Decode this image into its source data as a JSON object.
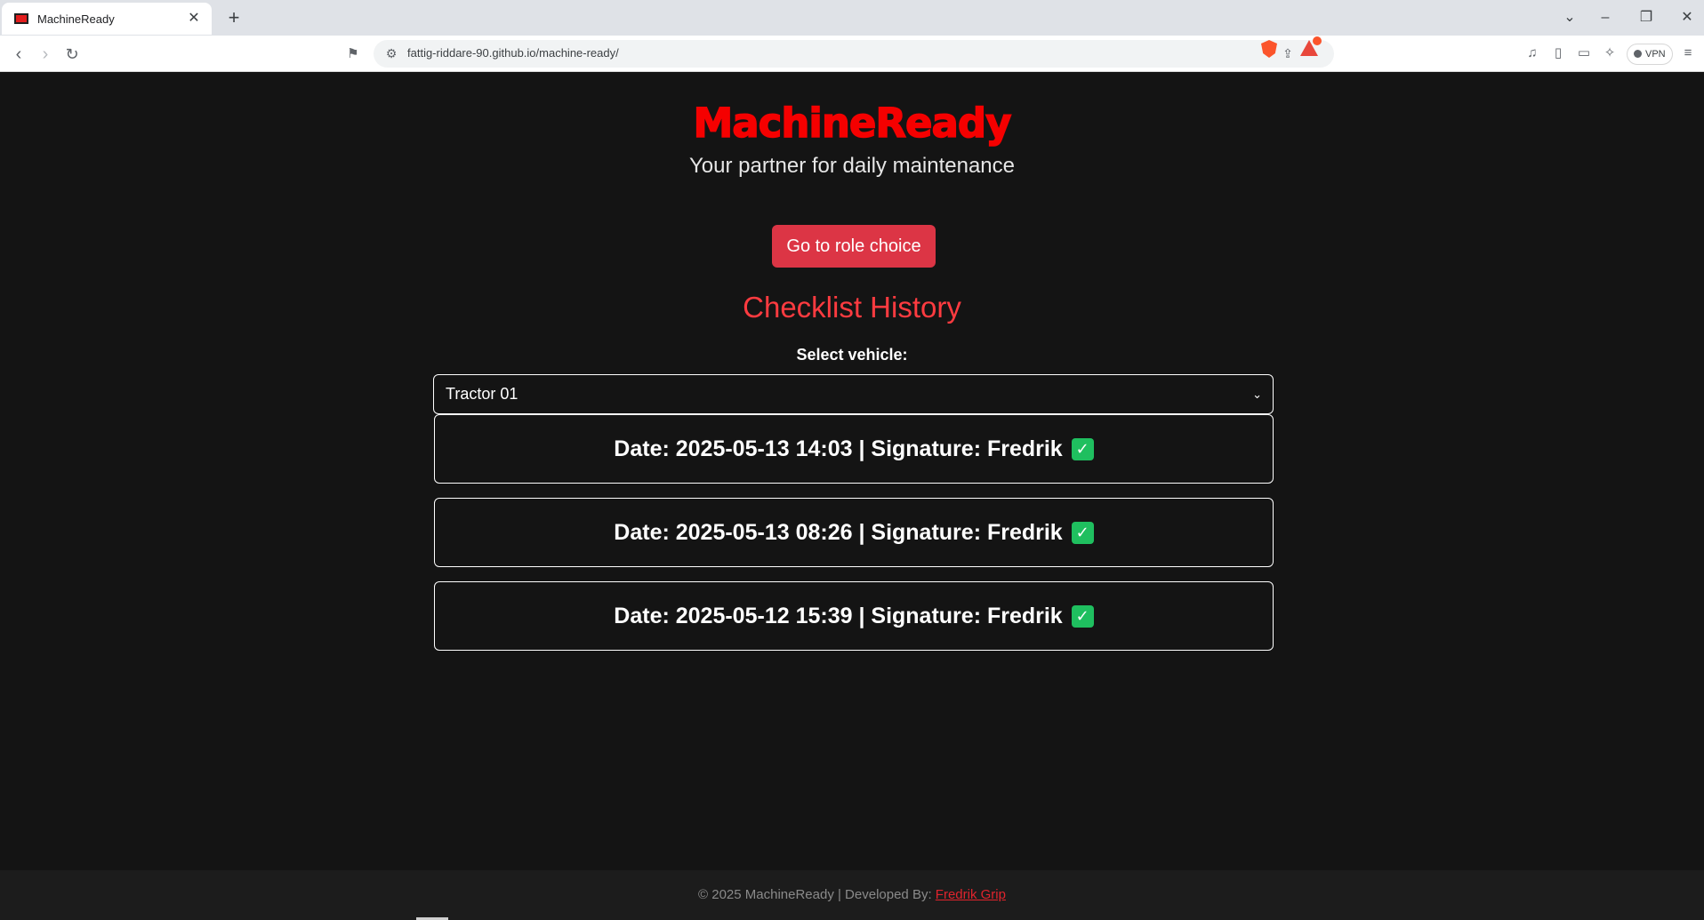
{
  "browser": {
    "tab_title": "MachineReady",
    "url": "fattig-riddare-90.github.io/machine-ready/",
    "vpn_label": "VPN",
    "accent": "#fb542b"
  },
  "header": {
    "logo": "MachineReady",
    "tagline": "Your partner for daily maintenance",
    "role_button": "Go to role choice",
    "brand_color": "#f50000",
    "button_color": "#dc3545"
  },
  "history": {
    "title": "Checklist History",
    "select_label": "Select vehicle:",
    "selected_vehicle": "Tractor 01",
    "entries": [
      {
        "label": "Date: 2025-05-13 14:03 | Signature: Fredrik",
        "status_icon": "check-icon"
      },
      {
        "label": "Date: 2025-05-13 08:26 | Signature: Fredrik",
        "status_icon": "check-icon"
      },
      {
        "label": "Date: 2025-05-12 15:39 | Signature: Fredrik",
        "status_icon": "check-icon"
      }
    ]
  },
  "footer": {
    "text": "© 2025 MachineReady | Developed By: ",
    "link_text": "Fredrik Grip"
  }
}
